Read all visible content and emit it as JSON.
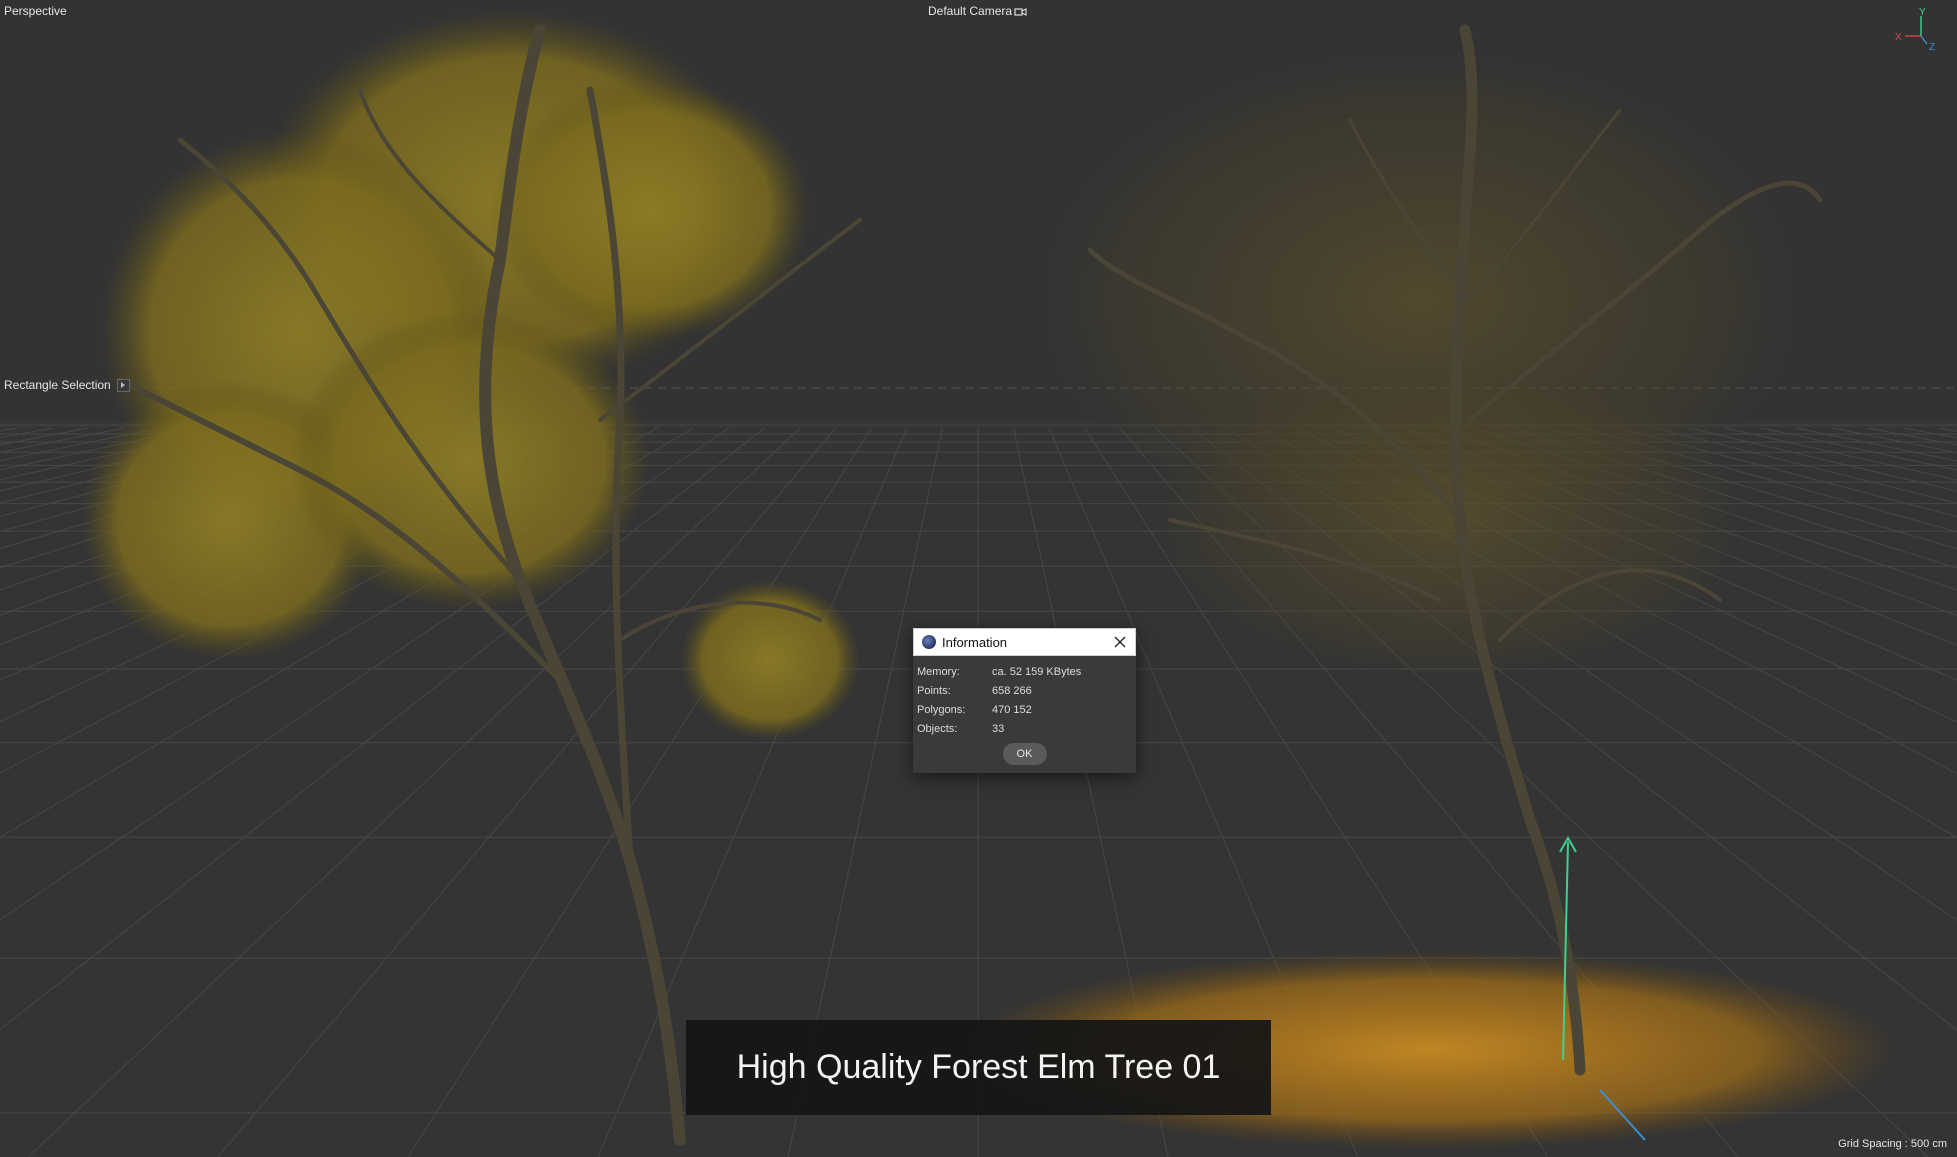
{
  "viewport": {
    "title": "Perspective",
    "camera": "Default Camera",
    "tool": "Rectangle Selection",
    "grid_spacing": "Grid Spacing : 500 cm"
  },
  "axis_gizmo": {
    "y": "Y",
    "x": "X",
    "z": "Z",
    "colors": {
      "x": "#d24b4b",
      "y": "#3fcf8e",
      "z": "#3a8fd0"
    }
  },
  "dialog": {
    "title": "Information",
    "rows": [
      {
        "key": "Memory:",
        "value": "ca. 52 159 KBytes"
      },
      {
        "key": "Points:",
        "value": "658 266"
      },
      {
        "key": "Polygons:",
        "value": "470 152"
      },
      {
        "key": "Objects:",
        "value": "33"
      }
    ],
    "ok_label": "OK"
  },
  "caption": "High Quality Forest Elm Tree 01",
  "colors": {
    "background": "#333333",
    "grid": "#4a4a4a",
    "foliage": "#8a7a24",
    "leaves_ground": "#b07a1e",
    "bark": "#4b4636"
  }
}
